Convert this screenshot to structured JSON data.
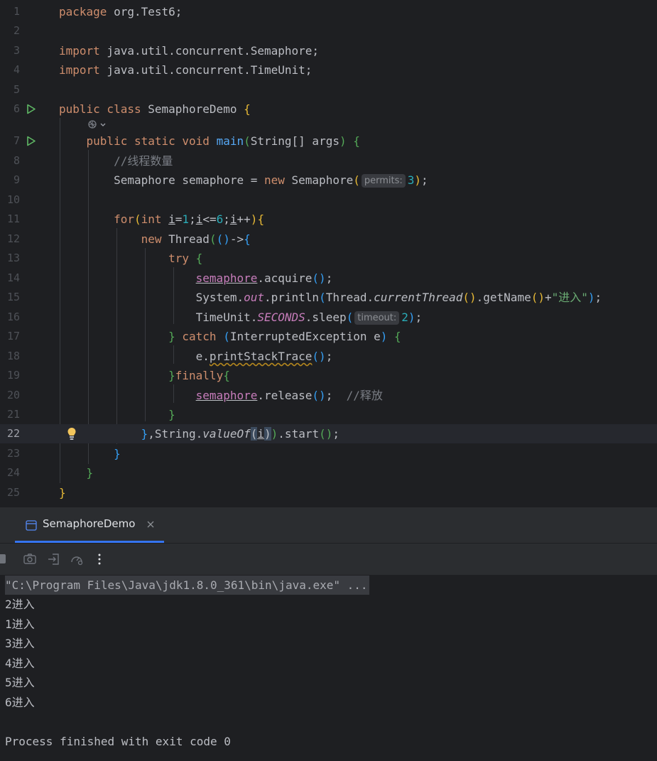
{
  "editor": {
    "line_numbers": [
      "1",
      "2",
      "3",
      "4",
      "5",
      "6",
      "7",
      "8",
      "9",
      "10",
      "11",
      "12",
      "13",
      "14",
      "15",
      "16",
      "17",
      "18",
      "19",
      "20",
      "21",
      "22",
      "23",
      "24",
      "25"
    ],
    "l1": {
      "kw": "package",
      "pkg": " org.Test6;"
    },
    "l3": {
      "kw": "import",
      "pkg": " java.util.concurrent.Semaphore;"
    },
    "l4": {
      "kw": "import",
      "pkg": " java.util.concurrent.TimeUnit;"
    },
    "l6": {
      "kw": "public class",
      "name": " SemaphoreDemo ",
      "brace": "{"
    },
    "l7": {
      "kw": "public static void",
      "fn": "main",
      "paren_open": "(",
      "params": "String[] args",
      "paren_close": ")",
      "brace": "{"
    },
    "l8": {
      "comment": "//线程数量"
    },
    "l9": {
      "type": "Semaphore semaphore = ",
      "kw": "new",
      "cls": " Semaphore",
      "paren_open": "(",
      "hint": "permits:",
      "num": "3",
      "paren_close": ")",
      "semi": ";"
    },
    "l11": {
      "kw_for": "for",
      "paren_open": "(",
      "kw_int": "int ",
      "var": "i",
      "eq": "=",
      "num1": "1",
      "semi1": ";",
      "var2": "i",
      "le": "<=",
      "num2": "6",
      "semi2": ";",
      "var3": "i",
      "inc": "++",
      "paren_close": ")",
      "brace": "{"
    },
    "l12": {
      "kw": "new",
      "cls": " Thread",
      "paren_open": "(",
      "lambda_open": "()",
      "arrow": "->",
      "brace": "{"
    },
    "l13": {
      "kw": "try",
      "brace": " {"
    },
    "l14": {
      "field": "semaphore",
      "call": ".acquire",
      "parens": "()",
      "semi": ";"
    },
    "l15": {
      "cls": "System.",
      "field": "out",
      "call": ".println",
      "paren_open": "(",
      "cls2": "Thread.",
      "it": "currentThread",
      "parens": "()",
      "call2": ".getName",
      "parens2": "()",
      "plus": "+",
      "str": "\"进入\"",
      "paren_close": ")",
      "semi": ";"
    },
    "l16": {
      "cls": "TimeUnit.",
      "const": "SECONDS",
      "call": ".sleep",
      "paren_open": "(",
      "hint": "timeout:",
      "num": "2",
      "paren_close": ")",
      "semi": ";"
    },
    "l17": {
      "brace_close": "}",
      "kw": " catch ",
      "paren_open": "(",
      "params": "InterruptedException e",
      "paren_close": ")",
      "brace": " {"
    },
    "l18": {
      "var": "e.",
      "call": "printStackTrace",
      "parens": "()",
      "semi": ";"
    },
    "l19": {
      "brace_close": "}",
      "kw": "finally",
      "brace": "{"
    },
    "l20": {
      "field": "semaphore",
      "call": ".release",
      "parens": "()",
      "semi": ";  ",
      "comment": "//释放"
    },
    "l21": {
      "brace": "}"
    },
    "l22": {
      "brace": "}",
      "rest": ",String.",
      "it": "valueOf",
      "paren_open": "(",
      "var": "i",
      "paren_close": ")",
      "paren_close2": ")",
      "call": ".start",
      "parens": "()",
      "semi": ";"
    },
    "l23": {
      "brace": "}"
    },
    "l24": {
      "brace": "}"
    },
    "l25": {
      "brace": "}"
    },
    "current_line": "22"
  },
  "run_panel": {
    "tab_label": "SemaphoreDemo",
    "toolbar_icons": [
      "stop-icon",
      "camera-icon",
      "login-icon",
      "profiler-icon",
      "more-vertical-icon"
    ]
  },
  "console": {
    "command": "\"C:\\Program Files\\Java\\jdk1.8.0_361\\bin\\java.exe\" ...",
    "output": [
      "2进入",
      "1进入",
      "3进入",
      "4进入",
      "5进入",
      "6进入"
    ],
    "exit_message": "Process finished with exit code 0"
  },
  "colors": {
    "background": "#1e1f22",
    "keyword": "#cf8e6d",
    "function": "#56a8f5",
    "string": "#6aab73",
    "number": "#2aacb8",
    "static_field": "#c77dbb",
    "comment": "#7a7e85",
    "accent": "#3574f0"
  }
}
